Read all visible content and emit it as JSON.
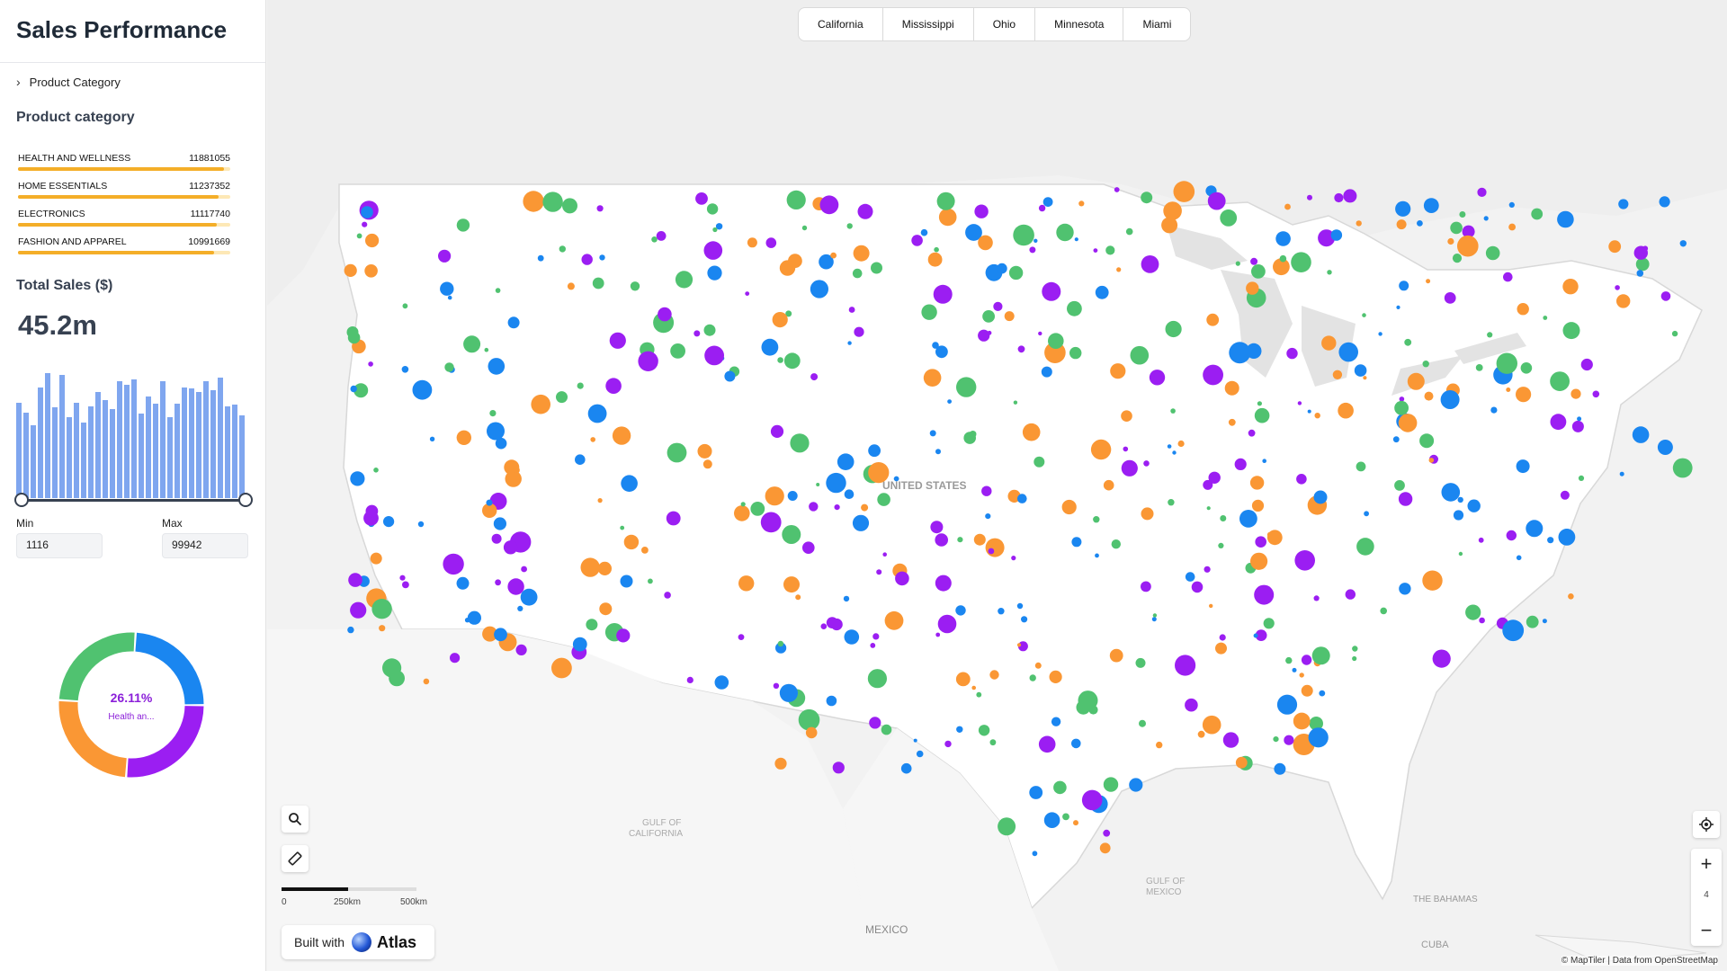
{
  "app": {
    "title": "Sales Performance"
  },
  "sidebar": {
    "accordion_label": "Product Category",
    "category_title": "Product category",
    "categories": [
      {
        "label": "HEALTH AND WELLNESS",
        "value": "11881055",
        "fraction": 0.972
      },
      {
        "label": "HOME ESSENTIALS",
        "value": "11237352",
        "fraction": 0.945
      },
      {
        "label": "ELECTRONICS",
        "value": "11117740",
        "fraction": 0.935
      },
      {
        "label": "FASHION AND APPAREL",
        "value": "10991669",
        "fraction": 0.925
      }
    ],
    "total_title": "Total Sales ($)",
    "total_value": "45.2m",
    "histogram": [
      0.76,
      0.68,
      0.58,
      0.88,
      0.99,
      0.72,
      0.98,
      0.64,
      0.76,
      0.6,
      0.73,
      0.84,
      0.78,
      0.71,
      0.93,
      0.9,
      0.94,
      0.67,
      0.81,
      0.75,
      0.93,
      0.64,
      0.75,
      0.88,
      0.87,
      0.84,
      0.93,
      0.86,
      0.96,
      0.73,
      0.74,
      0.66
    ],
    "min_label": "Min",
    "max_label": "Max",
    "min_value": "1116",
    "max_value": "99942",
    "donut": {
      "percent": "26.11%",
      "label": "Health an...",
      "segments": [
        {
          "name": "blue",
          "fraction": 0.241,
          "color": "#1a86f0"
        },
        {
          "name": "purple",
          "fraction": 0.261,
          "color": "#9b1ef2"
        },
        {
          "name": "orange",
          "fraction": 0.249,
          "color": "#fa9734"
        },
        {
          "name": "green",
          "fraction": 0.249,
          "color": "#50c270"
        }
      ]
    }
  },
  "map": {
    "tabs": [
      "California",
      "Mississippi",
      "Ohio",
      "Minnesota",
      "Miami"
    ],
    "labels": {
      "country": "UNITED STATES",
      "gulf_ca_1": "GULF OF",
      "gulf_ca_2": "CALIFORNIA",
      "gulf_mx_1": "GULF OF",
      "gulf_mx_2": "MEXICO",
      "mexico": "MEXICO",
      "bahamas": "THE BAHAMAS",
      "cuba": "CUBA"
    },
    "zoom_level": "4",
    "scale_labels": [
      "0",
      "250km",
      "500km"
    ],
    "built_with": "Built with",
    "brand": "Atlas",
    "attribution": "© MapTiler | Data from OpenStreetMap",
    "point_colors": [
      "#1a86f0",
      "#9b1ef2",
      "#fa9734",
      "#50c270"
    ]
  },
  "icons": {
    "search": "search-icon",
    "ruler": "ruler-icon",
    "locate": "locate-icon",
    "zoom_in": "plus-icon",
    "zoom_out": "minus-icon"
  }
}
